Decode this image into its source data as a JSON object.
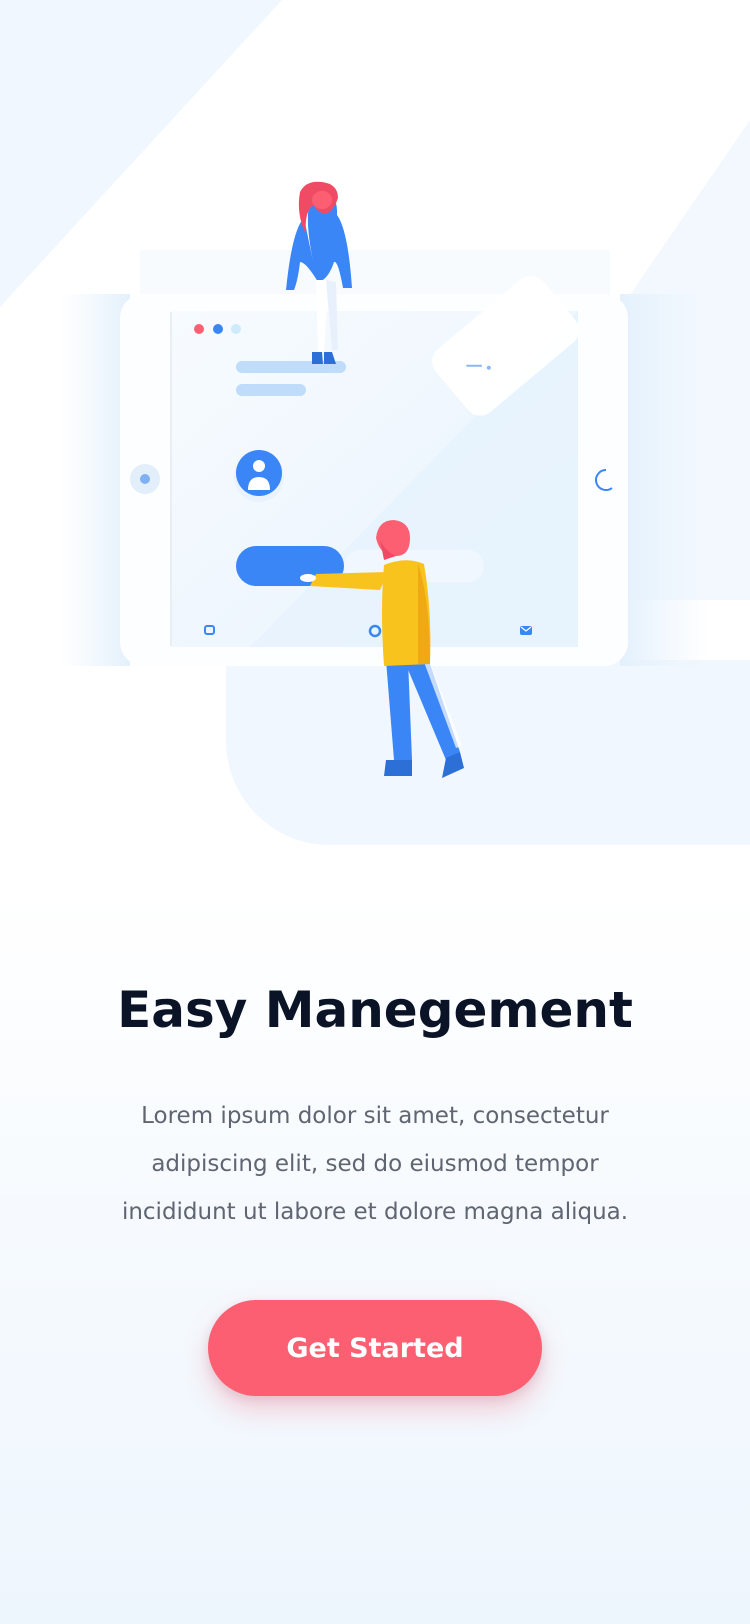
{
  "onboarding": {
    "title": "Easy Manegement",
    "description_lines": [
      "Lorem ipsum dolor sit amet, consectetur",
      "adipiscing elit, sed do eiusmod tempor",
      "incididunt ut labore et dolore magna aliqua."
    ],
    "cta_label": "Get Started"
  },
  "colors": {
    "accent": "#fd5f72",
    "primary_blue": "#3a86f7",
    "title": "#0b1426",
    "body_text": "#5f6571",
    "character_yellow": "#f8c31d"
  },
  "illustration": {
    "icons": [
      "chat-icon",
      "home-icon",
      "mail-icon",
      "user-avatar-icon",
      "speaker-icon",
      "loading-icon"
    ]
  }
}
